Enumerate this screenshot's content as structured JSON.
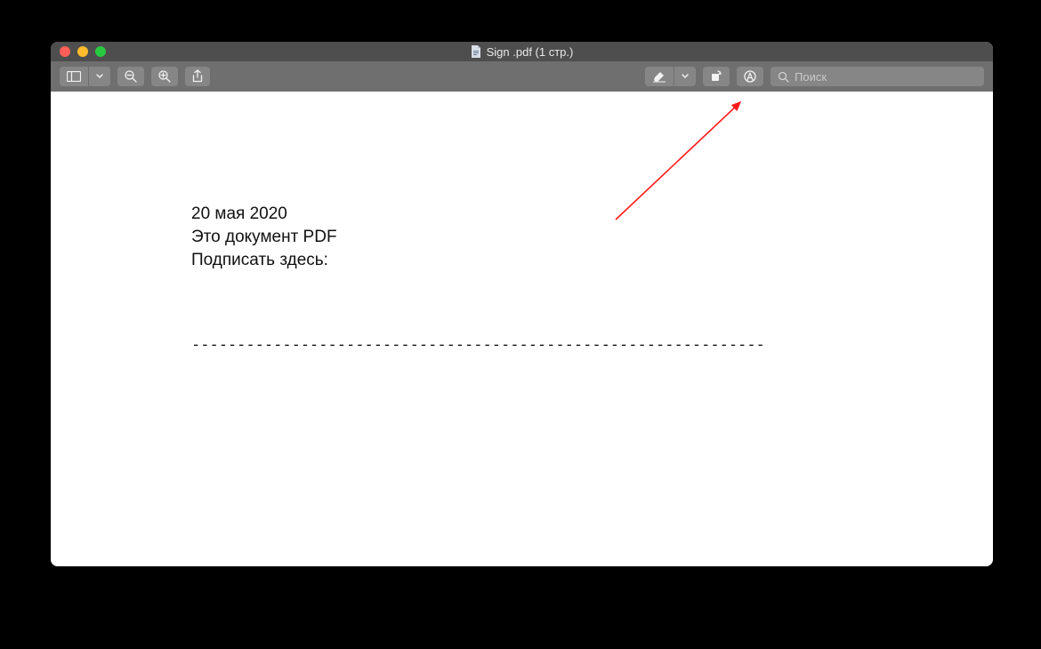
{
  "window": {
    "title": "Sign .pdf (1 стр.)"
  },
  "toolbar": {
    "sidebar": "Sidebar",
    "zoom_out": "Zoom Out",
    "zoom_in": "Zoom In",
    "share": "Share",
    "highlight": "Highlight",
    "highlight_dropdown": "Highlight options",
    "rotate": "Rotate",
    "markup": "Markup",
    "search_placeholder": "Поиск"
  },
  "document": {
    "line_date": "20 мая 2020",
    "line_desc": "Это документ PDF",
    "line_sign": "Подписать здесь:",
    "signature_rule": "---------------------------------------------------------------"
  },
  "colors": {
    "window_chrome": "#6f6f6f",
    "titlebar": "#4e4e4e",
    "button": "#868686",
    "annotation_arrow": "#ff1a1a"
  }
}
